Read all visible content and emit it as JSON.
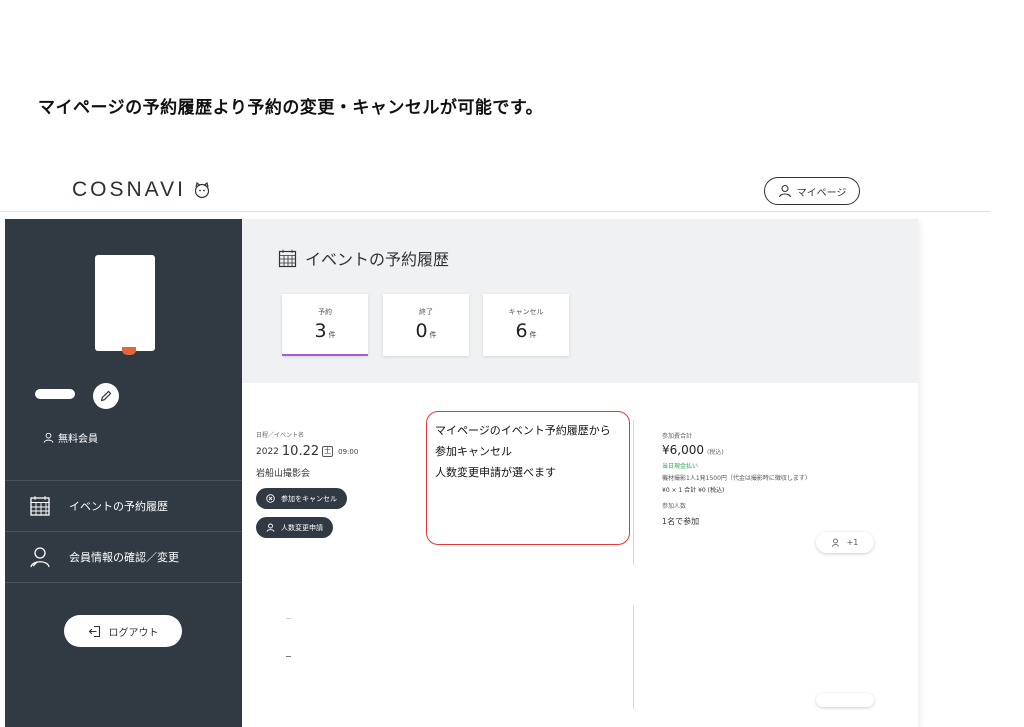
{
  "caption": "マイページの予約履歴より予約の変更・キャンセルが可能です。",
  "header": {
    "logo": "COSNAVI",
    "mypage_label": "マイページ"
  },
  "sidebar": {
    "member_type": "無料会員",
    "nav": [
      {
        "label": "イベントの予約履歴"
      },
      {
        "label": "会員情報の確認／変更"
      }
    ],
    "logout_label": "ログアウト"
  },
  "main": {
    "title": "イベントの予約履歴",
    "tabs": [
      {
        "label": "予約",
        "count": "3",
        "unit": "件"
      },
      {
        "label": "終了",
        "count": "0",
        "unit": "件"
      },
      {
        "label": "キャンセル",
        "count": "6",
        "unit": "件"
      }
    ]
  },
  "event": {
    "label": "日程／イベント名",
    "year": "2022",
    "date": "10.22",
    "weekday": "土",
    "time": "09:00",
    "name": "岩船山撮影会",
    "cancel_label": "参加をキャンセル",
    "change_label": "人数変更申請"
  },
  "note": {
    "lines": [
      "マイページのイベント予約履歴から",
      "参加キャンセル",
      "人数変更申請が選べます"
    ]
  },
  "price": {
    "label": "参加費合計",
    "amount": "¥6,000",
    "tax": "(税込)",
    "payment": "当日現金払い",
    "note": "機材撮影1人1発1500円（代金は撮影時に徴収します）",
    "calc": "¥0 × 1  合計 ¥0 (税込)",
    "people_label": "参加人数",
    "people": "1名で参加",
    "plus_label": "+1"
  }
}
